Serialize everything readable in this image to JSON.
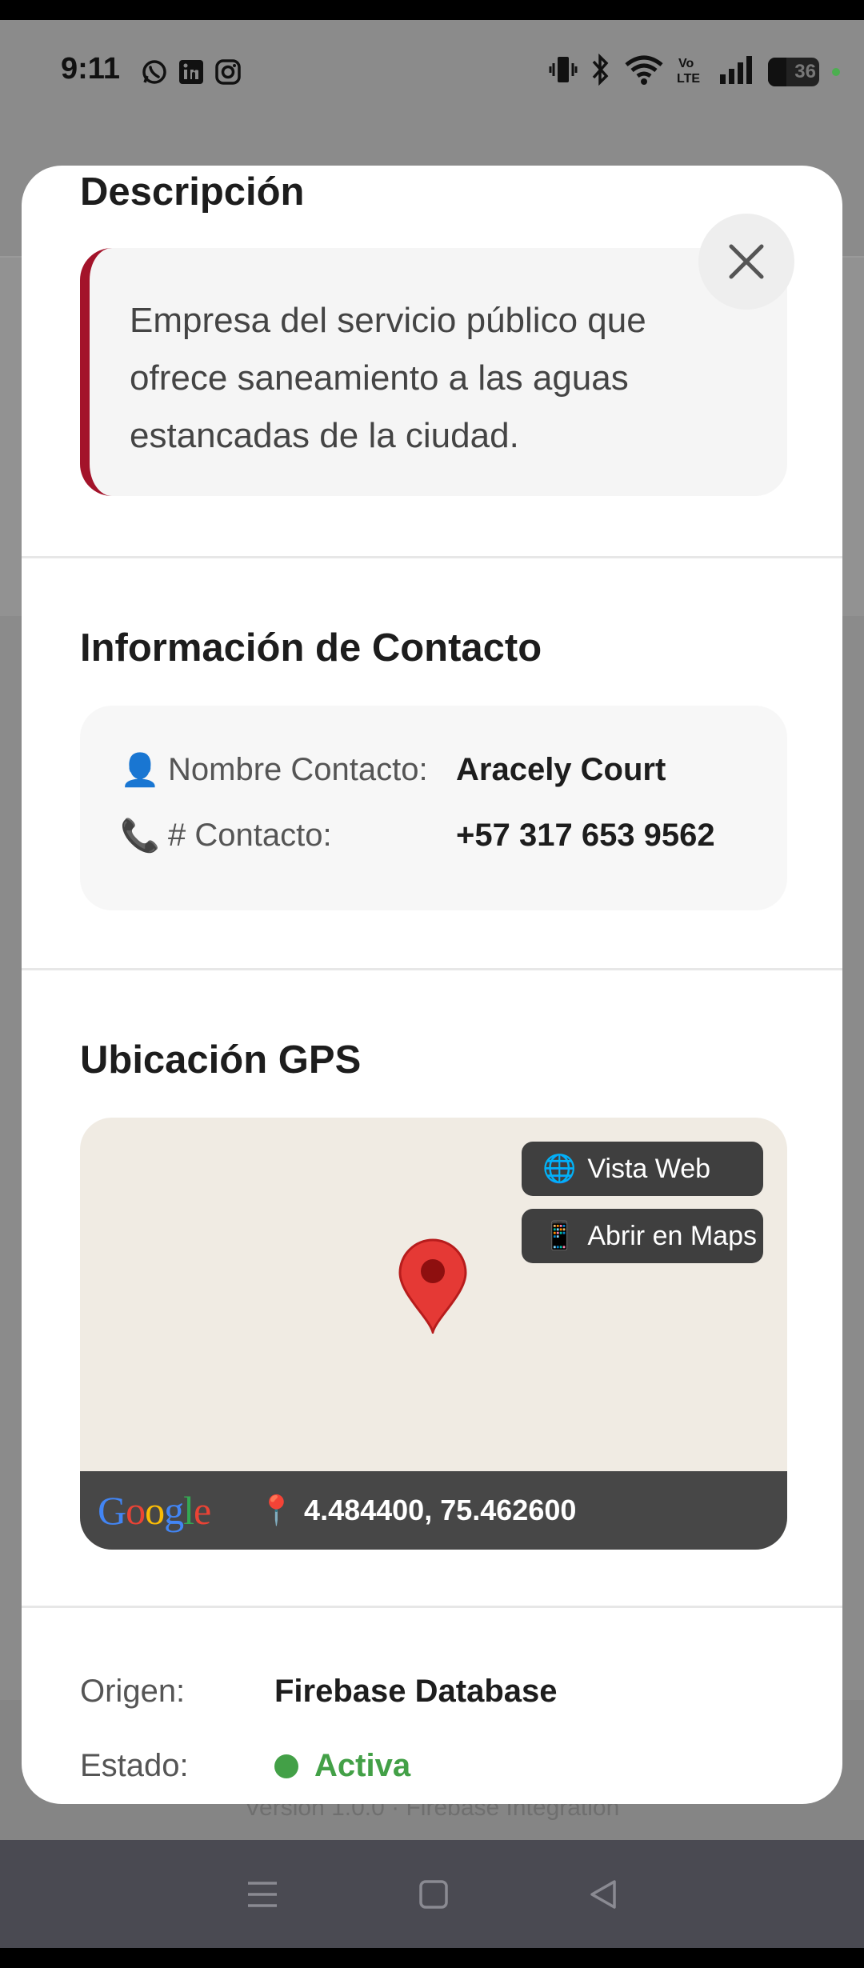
{
  "status_bar": {
    "time": "9:11",
    "battery_level": "36",
    "app_icons": [
      "whatsapp-icon",
      "linkedin-icon",
      "instagram-icon"
    ],
    "system_icons": [
      "vibrate-icon",
      "bluetooth-icon",
      "wifi-icon",
      "volte-icon",
      "signal-icon",
      "battery-icon"
    ]
  },
  "background": {
    "version_text": "Version 1.0.0 · Firebase Integration"
  },
  "modal": {
    "description": {
      "title": "Descripción",
      "text": "Empresa del servicio público que ofrece saneamiento a las aguas estancadas de la ciudad.",
      "accent_color": "#a3132a"
    },
    "contact": {
      "title": "Información de Contacto",
      "name_icon": "👤",
      "name_label": "Nombre Contacto:",
      "name_value": "Aracely Court",
      "phone_icon": "📞",
      "phone_label": "# Contacto:",
      "phone_value": "+57 317 653 9562"
    },
    "gps": {
      "title": "Ubicación GPS",
      "web_view_icon": "🌐",
      "web_view_label": "Vista Web",
      "open_maps_icon": "📱",
      "open_maps_label": "Abrir en Maps",
      "provider": "Google",
      "coords_icon": "📍",
      "coordinates": "4.484400, 75.462600"
    },
    "meta": {
      "origin_label": "Origen:",
      "origin_value": "Firebase Database",
      "status_label": "Estado:",
      "status_value": "Activa",
      "status_color": "#43a047"
    }
  },
  "nav_bar": {
    "buttons": [
      "menu-icon",
      "home-icon",
      "back-icon"
    ]
  }
}
